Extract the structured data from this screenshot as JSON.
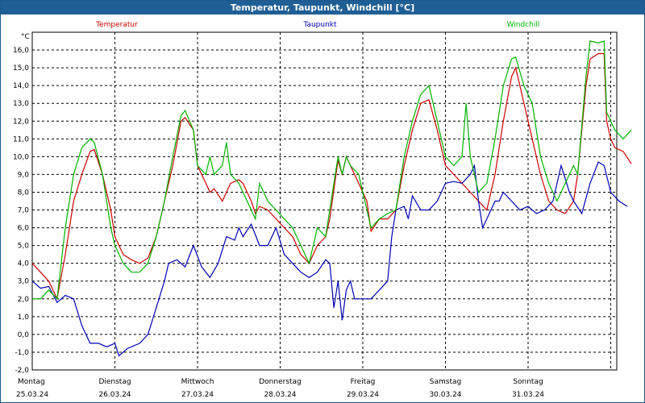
{
  "title": "Temperatur, Taupunkt, Windchill [°C]",
  "unit_label": "°C",
  "colors": {
    "grid": "#000000",
    "titlebar_bg": "#1f5f95"
  },
  "chart_data": {
    "type": "line",
    "ylim": [
      -2.0,
      17.0
    ],
    "xlim": [
      0,
      7
    ],
    "grid": true,
    "legend": "top",
    "y_ticks": [
      "-2,0",
      "-1,0",
      "0,0",
      "1,0",
      "2,0",
      "3,0",
      "4,0",
      "5,0",
      "6,0",
      "7,0",
      "8,0",
      "9,0",
      "10,0",
      "11,0",
      "12,0",
      "13,0",
      "14,0",
      "15,0",
      "16,0"
    ],
    "x_ticks": [
      {
        "day": "Montag",
        "date": "25.03.24"
      },
      {
        "day": "Dienstag",
        "date": "26.03.24"
      },
      {
        "day": "Mittwoch",
        "date": "27.03.24"
      },
      {
        "day": "Donnerstag",
        "date": "28.03.24"
      },
      {
        "day": "Freitag",
        "date": "29.03.24"
      },
      {
        "day": "Samstag",
        "date": "30.03.24"
      },
      {
        "day": "Sonntag",
        "date": "31.03.24"
      }
    ],
    "series": [
      {
        "name": "Temperatur",
        "color": "#cc0000",
        "points": [
          [
            0,
            4.0
          ],
          [
            0.1,
            3.5
          ],
          [
            0.2,
            3.0
          ],
          [
            0.3,
            2.0
          ],
          [
            0.4,
            4.5
          ],
          [
            0.5,
            7.5
          ],
          [
            0.6,
            9.0
          ],
          [
            0.7,
            10.3
          ],
          [
            0.75,
            10.4
          ],
          [
            0.85,
            9.0
          ],
          [
            0.95,
            7.0
          ],
          [
            1.0,
            5.5
          ],
          [
            1.1,
            4.5
          ],
          [
            1.2,
            4.2
          ],
          [
            1.3,
            4.0
          ],
          [
            1.4,
            4.3
          ],
          [
            1.5,
            5.5
          ],
          [
            1.6,
            7.5
          ],
          [
            1.7,
            9.5
          ],
          [
            1.8,
            12.0
          ],
          [
            1.85,
            12.2
          ],
          [
            1.95,
            11.5
          ],
          [
            2.0,
            9.5
          ],
          [
            2.1,
            8.5
          ],
          [
            2.15,
            8.0
          ],
          [
            2.2,
            8.2
          ],
          [
            2.3,
            7.5
          ],
          [
            2.4,
            8.5
          ],
          [
            2.5,
            8.7
          ],
          [
            2.55,
            8.5
          ],
          [
            2.65,
            7.5
          ],
          [
            2.7,
            6.8
          ],
          [
            2.75,
            7.2
          ],
          [
            2.85,
            7.0
          ],
          [
            2.95,
            6.5
          ],
          [
            3.05,
            6.0
          ],
          [
            3.15,
            5.5
          ],
          [
            3.25,
            4.5
          ],
          [
            3.35,
            4.0
          ],
          [
            3.45,
            5.0
          ],
          [
            3.55,
            5.5
          ],
          [
            3.6,
            6.5
          ],
          [
            3.7,
            9.8
          ],
          [
            3.75,
            9.0
          ],
          [
            3.8,
            10.0
          ],
          [
            3.85,
            9.5
          ],
          [
            3.95,
            8.5
          ],
          [
            4.0,
            8.0
          ],
          [
            4.05,
            7.5
          ],
          [
            4.1,
            5.8
          ],
          [
            4.2,
            6.5
          ],
          [
            4.3,
            6.5
          ],
          [
            4.4,
            7.0
          ],
          [
            4.5,
            9.5
          ],
          [
            4.6,
            11.5
          ],
          [
            4.7,
            13.0
          ],
          [
            4.8,
            13.2
          ],
          [
            4.9,
            11.5
          ],
          [
            5.0,
            9.5
          ],
          [
            5.1,
            9.0
          ],
          [
            5.2,
            8.5
          ],
          [
            5.3,
            8.0
          ],
          [
            5.4,
            7.5
          ],
          [
            5.5,
            7.0
          ],
          [
            5.6,
            9.0
          ],
          [
            5.7,
            12.0
          ],
          [
            5.8,
            14.5
          ],
          [
            5.85,
            15.0
          ],
          [
            5.95,
            13.0
          ],
          [
            6.05,
            11.0
          ],
          [
            6.15,
            9.0
          ],
          [
            6.25,
            7.5
          ],
          [
            6.35,
            7.0
          ],
          [
            6.45,
            6.8
          ],
          [
            6.55,
            7.5
          ],
          [
            6.6,
            9.0
          ],
          [
            6.7,
            14.0
          ],
          [
            6.75,
            15.5
          ],
          [
            6.85,
            15.8
          ],
          [
            6.92,
            15.8
          ],
          [
            6.95,
            12.0
          ],
          [
            7.0,
            11.0
          ],
          [
            7.05,
            10.5
          ],
          [
            7.15,
            10.3
          ],
          [
            7.25,
            9.6
          ]
        ]
      },
      {
        "name": "Taupunkt",
        "color": "#0000b4",
        "points": [
          [
            0,
            3.0
          ],
          [
            0.1,
            2.6
          ],
          [
            0.2,
            2.7
          ],
          [
            0.3,
            1.8
          ],
          [
            0.4,
            2.2
          ],
          [
            0.5,
            2.0
          ],
          [
            0.6,
            0.5
          ],
          [
            0.7,
            -0.5
          ],
          [
            0.8,
            -0.5
          ],
          [
            0.9,
            -0.7
          ],
          [
            1.0,
            -0.5
          ],
          [
            1.05,
            -1.2
          ],
          [
            1.15,
            -0.8
          ],
          [
            1.3,
            -0.5
          ],
          [
            1.4,
            0.0
          ],
          [
            1.5,
            1.5
          ],
          [
            1.6,
            3.0
          ],
          [
            1.65,
            4.0
          ],
          [
            1.75,
            4.2
          ],
          [
            1.85,
            3.8
          ],
          [
            1.95,
            5.0
          ],
          [
            2.05,
            3.8
          ],
          [
            2.15,
            3.2
          ],
          [
            2.25,
            4.0
          ],
          [
            2.35,
            5.5
          ],
          [
            2.45,
            5.3
          ],
          [
            2.5,
            6.0
          ],
          [
            2.55,
            5.5
          ],
          [
            2.65,
            6.2
          ],
          [
            2.75,
            5.0
          ],
          [
            2.85,
            5.0
          ],
          [
            2.95,
            6.0
          ],
          [
            3.05,
            4.5
          ],
          [
            3.15,
            4.0
          ],
          [
            3.25,
            3.5
          ],
          [
            3.35,
            3.2
          ],
          [
            3.45,
            3.5
          ],
          [
            3.55,
            4.2
          ],
          [
            3.6,
            4.0
          ],
          [
            3.65,
            1.5
          ],
          [
            3.7,
            3.0
          ],
          [
            3.75,
            0.8
          ],
          [
            3.8,
            2.5
          ],
          [
            3.85,
            3.0
          ],
          [
            3.9,
            2.0
          ],
          [
            4.0,
            2.0
          ],
          [
            4.1,
            2.0
          ],
          [
            4.2,
            2.5
          ],
          [
            4.3,
            3.0
          ],
          [
            4.35,
            5.5
          ],
          [
            4.4,
            7.0
          ],
          [
            4.5,
            7.2
          ],
          [
            4.55,
            6.5
          ],
          [
            4.6,
            7.8
          ],
          [
            4.7,
            7.0
          ],
          [
            4.8,
            7.0
          ],
          [
            4.9,
            7.5
          ],
          [
            5.0,
            8.5
          ],
          [
            5.1,
            8.6
          ],
          [
            5.2,
            8.5
          ],
          [
            5.3,
            9.0
          ],
          [
            5.35,
            9.5
          ],
          [
            5.4,
            7.5
          ],
          [
            5.45,
            6.0
          ],
          [
            5.5,
            6.5
          ],
          [
            5.6,
            7.5
          ],
          [
            5.65,
            7.5
          ],
          [
            5.7,
            8.0
          ],
          [
            5.8,
            7.5
          ],
          [
            5.9,
            7.0
          ],
          [
            6.0,
            7.2
          ],
          [
            6.1,
            6.8
          ],
          [
            6.2,
            7.0
          ],
          [
            6.3,
            7.5
          ],
          [
            6.4,
            9.5
          ],
          [
            6.5,
            8.0
          ],
          [
            6.55,
            7.5
          ],
          [
            6.65,
            6.8
          ],
          [
            6.75,
            8.5
          ],
          [
            6.85,
            9.7
          ],
          [
            6.92,
            9.5
          ],
          [
            7.0,
            8.0
          ],
          [
            7.1,
            7.5
          ],
          [
            7.2,
            7.2
          ]
        ]
      },
      {
        "name": "Windchill",
        "color": "#00b400",
        "points": [
          [
            0,
            2.0
          ],
          [
            0.1,
            2.0
          ],
          [
            0.2,
            2.5
          ],
          [
            0.3,
            2.0
          ],
          [
            0.4,
            6.0
          ],
          [
            0.5,
            9.0
          ],
          [
            0.6,
            10.5
          ],
          [
            0.7,
            11.0
          ],
          [
            0.75,
            10.8
          ],
          [
            0.85,
            9.0
          ],
          [
            0.95,
            6.0
          ],
          [
            1.0,
            5.0
          ],
          [
            1.1,
            4.0
          ],
          [
            1.2,
            3.5
          ],
          [
            1.3,
            3.5
          ],
          [
            1.4,
            4.0
          ],
          [
            1.5,
            5.5
          ],
          [
            1.6,
            7.5
          ],
          [
            1.7,
            10.0
          ],
          [
            1.8,
            12.3
          ],
          [
            1.85,
            12.6
          ],
          [
            1.95,
            11.5
          ],
          [
            2.0,
            9.5
          ],
          [
            2.1,
            9.0
          ],
          [
            2.15,
            10.0
          ],
          [
            2.2,
            9.0
          ],
          [
            2.3,
            9.5
          ],
          [
            2.35,
            10.8
          ],
          [
            2.4,
            9.0
          ],
          [
            2.5,
            8.5
          ],
          [
            2.55,
            8.0
          ],
          [
            2.65,
            7.0
          ],
          [
            2.7,
            6.5
          ],
          [
            2.75,
            8.5
          ],
          [
            2.85,
            7.5
          ],
          [
            2.95,
            7.0
          ],
          [
            3.05,
            6.5
          ],
          [
            3.15,
            6.0
          ],
          [
            3.25,
            5.0
          ],
          [
            3.35,
            4.0
          ],
          [
            3.45,
            6.0
          ],
          [
            3.55,
            5.5
          ],
          [
            3.6,
            7.0
          ],
          [
            3.7,
            10.0
          ],
          [
            3.75,
            9.0
          ],
          [
            3.8,
            10.0
          ],
          [
            3.85,
            9.5
          ],
          [
            3.95,
            9.0
          ],
          [
            4.0,
            8.0
          ],
          [
            4.05,
            7.0
          ],
          [
            4.1,
            6.0
          ],
          [
            4.2,
            6.5
          ],
          [
            4.3,
            6.8
          ],
          [
            4.4,
            7.0
          ],
          [
            4.5,
            10.0
          ],
          [
            4.6,
            12.0
          ],
          [
            4.7,
            13.5
          ],
          [
            4.8,
            14.0
          ],
          [
            4.9,
            12.0
          ],
          [
            5.0,
            10.0
          ],
          [
            5.1,
            9.5
          ],
          [
            5.2,
            10.0
          ],
          [
            5.25,
            13.0
          ],
          [
            5.3,
            10.0
          ],
          [
            5.4,
            8.0
          ],
          [
            5.5,
            8.5
          ],
          [
            5.6,
            11.0
          ],
          [
            5.7,
            14.0
          ],
          [
            5.8,
            15.5
          ],
          [
            5.85,
            15.6
          ],
          [
            5.95,
            14.0
          ],
          [
            6.05,
            13.0
          ],
          [
            6.15,
            10.0
          ],
          [
            6.25,
            8.5
          ],
          [
            6.35,
            7.5
          ],
          [
            6.45,
            8.5
          ],
          [
            6.55,
            9.5
          ],
          [
            6.6,
            9.0
          ],
          [
            6.7,
            14.5
          ],
          [
            6.75,
            16.5
          ],
          [
            6.85,
            16.4
          ],
          [
            6.92,
            16.5
          ],
          [
            6.95,
            12.5
          ],
          [
            7.0,
            12.0
          ],
          [
            7.05,
            11.5
          ],
          [
            7.15,
            11.0
          ],
          [
            7.25,
            11.5
          ]
        ]
      }
    ]
  }
}
